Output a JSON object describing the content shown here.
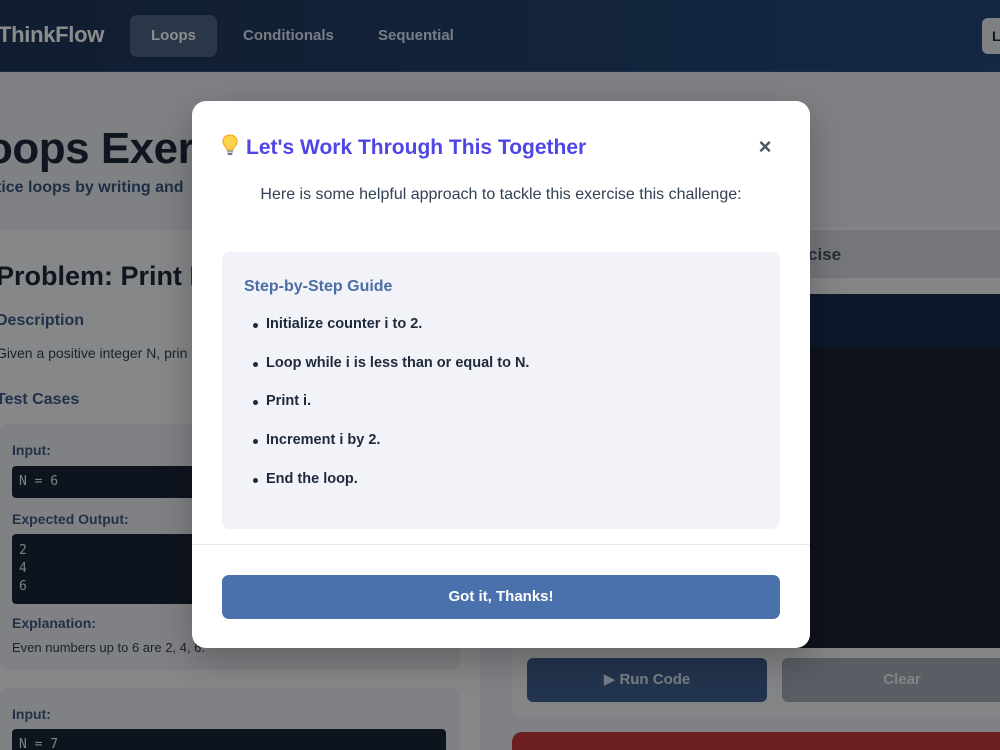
{
  "nav": {
    "brand": "ThinkFlow",
    "tabs": [
      {
        "label": "Loops",
        "active": true
      },
      {
        "label": "Conditionals",
        "active": false
      },
      {
        "label": "Sequential",
        "active": false
      }
    ],
    "right_button_label": "L"
  },
  "page": {
    "title": "oops Exerc",
    "subtitle": "tice loops by writing and",
    "problem_title": "Problem: Print E",
    "description_heading": "Description",
    "description_text": "Given a positive integer N, prin",
    "test_cases_heading": "Test Cases",
    "test_cases": [
      {
        "input_label": "Input:",
        "input_value": "N = 6",
        "output_label": "Expected Output:",
        "output_value": "2\n4\n6",
        "explanation_label": "Explanation:",
        "explanation_text": "Even numbers up to 6 are 2, 4, 6."
      },
      {
        "input_label": "Input:",
        "input_value": "N = 7"
      }
    ]
  },
  "editor": {
    "exercise_tab_label": "cise",
    "run_button": "▶ Run Code",
    "clear_button": "Clear"
  },
  "modal": {
    "title": "Let's Work Through This Together",
    "close_symbol": "×",
    "intro": "Here is some helpful approach to tackle this exercise this challenge:",
    "guide_title": "Step-by-Step Guide",
    "steps": [
      "Initialize counter i to 2.",
      "Loop while i is less than or equal to N.",
      "Print i.",
      "Increment i by 2.",
      "End the loop."
    ],
    "confirm_button": "Got it, Thanks!"
  },
  "colors": {
    "nav_bg": "#23416e",
    "modal_title": "#4f46e5",
    "primary_button": "#4a71ab",
    "guide_title": "#4b6ea3"
  }
}
